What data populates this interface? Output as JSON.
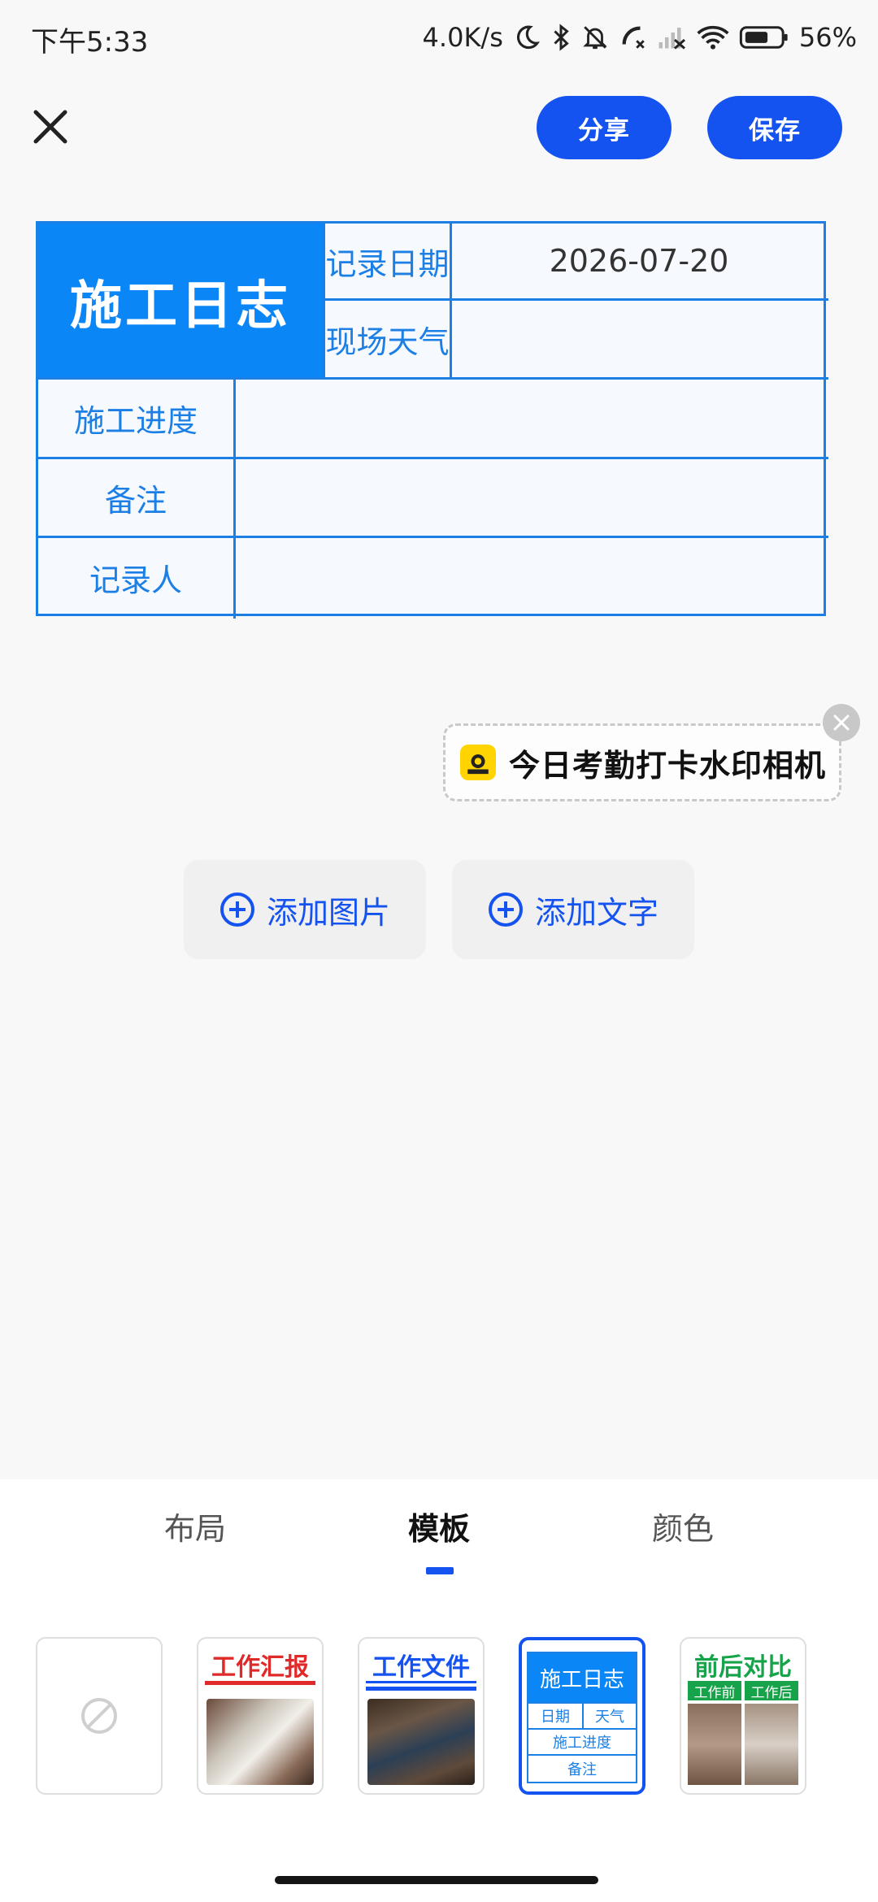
{
  "status_bar": {
    "time": "下午5:33",
    "network_speed": "4.0K/s",
    "battery": "56%",
    "icons": [
      "moon-icon",
      "bluetooth-icon",
      "mute-bell-icon",
      "call-forward-icon",
      "signal-off-icon",
      "wifi-icon",
      "battery-icon"
    ]
  },
  "top_bar": {
    "close_icon": "close-icon",
    "share_label": "分享",
    "save_label": "保存",
    "accent": "#1553f0"
  },
  "watermark": {
    "title": "施工日志",
    "rows": {
      "date_label": "记录日期",
      "date_value": "2026-07-20",
      "weather_label": "现场天气",
      "weather_value": "",
      "progress_label": "施工进度",
      "progress_value": "",
      "notes_label": "备注",
      "notes_value": "",
      "recorder_label": "记录人",
      "recorder_value": ""
    },
    "border_color": "#1b7fe6",
    "title_bg": "#0b86f7"
  },
  "sticker": {
    "logo_text": "水印相机",
    "text": "今日考勤打卡水印相机",
    "close_icon": "close-icon"
  },
  "actions": {
    "add_image": "添加图片",
    "add_text": "添加文字",
    "icon": "plus-circle-icon"
  },
  "tabs": {
    "layout": "布局",
    "template": "模板",
    "color": "颜色",
    "active": "模板"
  },
  "templates": {
    "none_icon": "none-icon",
    "work_report": {
      "title": "工作汇报",
      "color": "#e02a2a"
    },
    "work_file": {
      "title": "工作文件",
      "color": "#1553f0"
    },
    "construction_log": {
      "title": "施工日志",
      "date": "日期",
      "weather": "天气",
      "progress": "施工进度",
      "notes": "备注"
    },
    "before_after": {
      "title": "前后对比",
      "before": "工作前",
      "after": "工作后",
      "color": "#17a34a"
    },
    "selected": "construction_log"
  }
}
